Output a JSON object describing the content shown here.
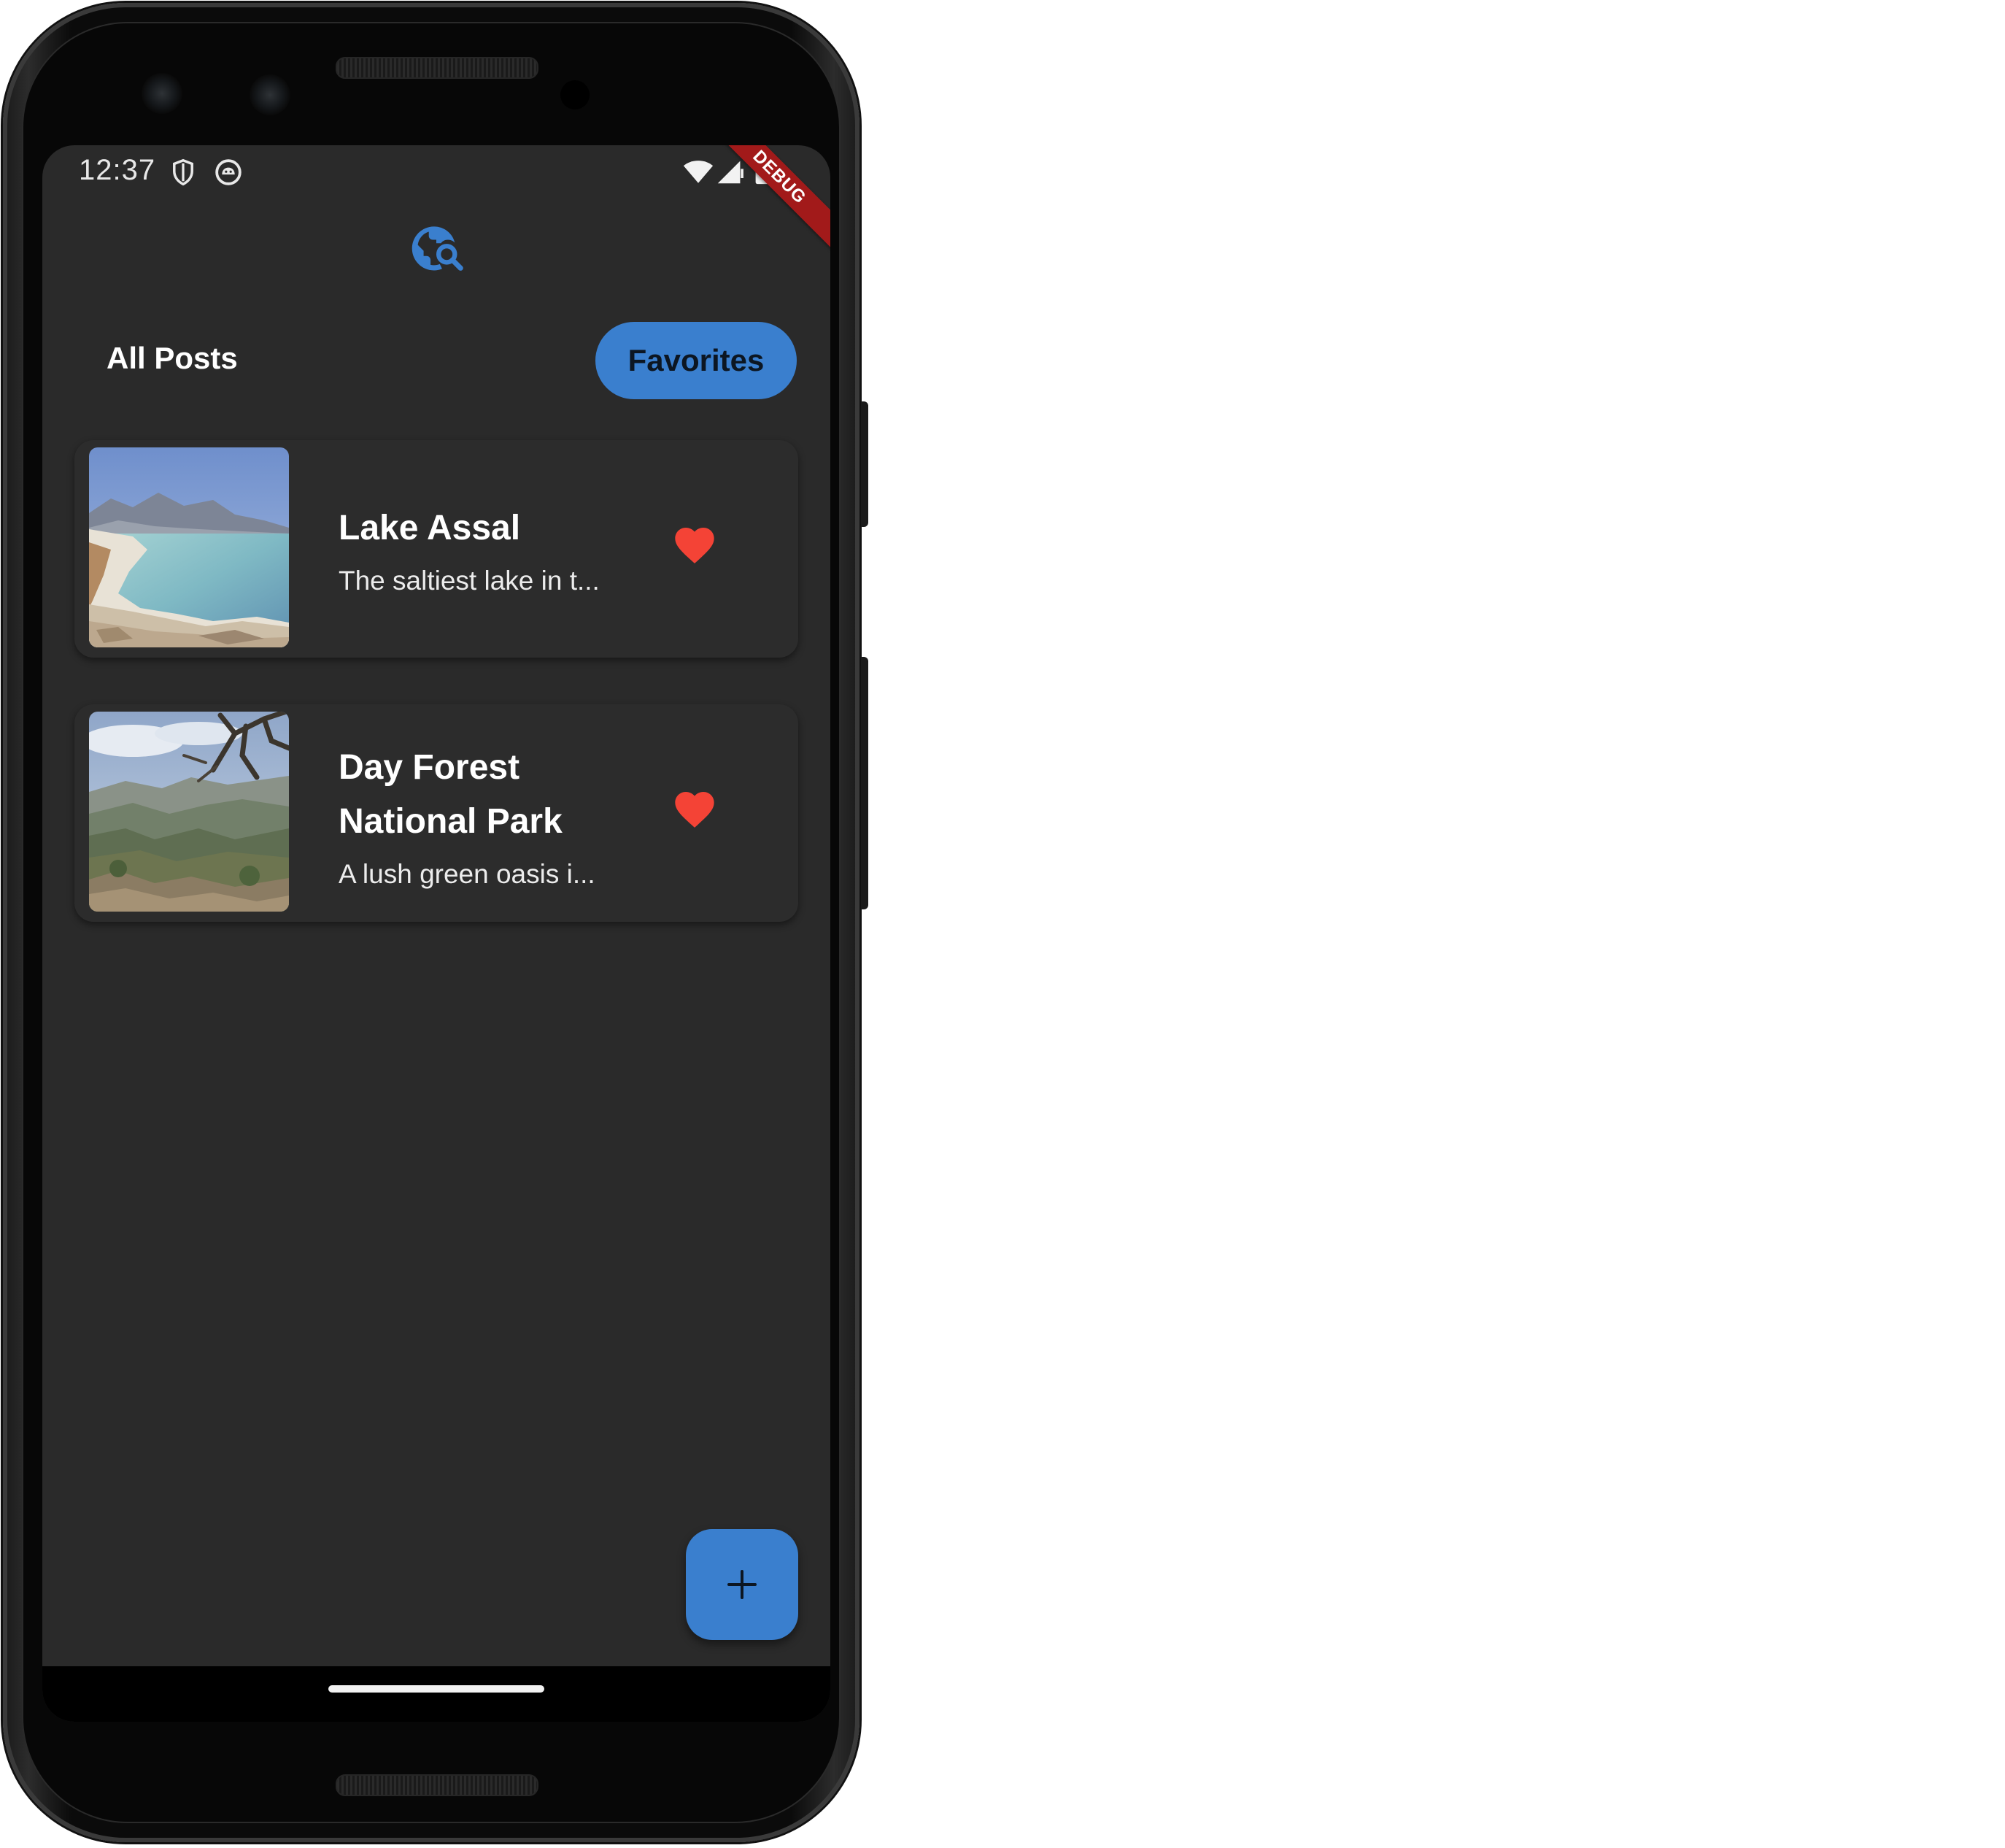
{
  "status_bar": {
    "time": "12:37",
    "icons": [
      "shield-icon",
      "android-icon",
      "wifi-icon",
      "signal-icon",
      "battery-icon"
    ]
  },
  "debug_banner": "DEBUG",
  "app": {
    "logo_icon": "travel-explore-icon",
    "accent_color": "#3a7fce",
    "background_color": "#2a2a2a"
  },
  "tabs": {
    "all_posts": "All Posts",
    "favorites": "Favorites",
    "selected": "Favorites"
  },
  "posts": [
    {
      "title": "Lake Assal",
      "description": "The saltiest lake in t...",
      "favorite": true
    },
    {
      "title": "Day Forest National Park",
      "description": "A lush green oasis i...",
      "favorite": true
    }
  ],
  "fab": {
    "icon": "plus-icon"
  },
  "colors": {
    "heart": "#f44336"
  }
}
